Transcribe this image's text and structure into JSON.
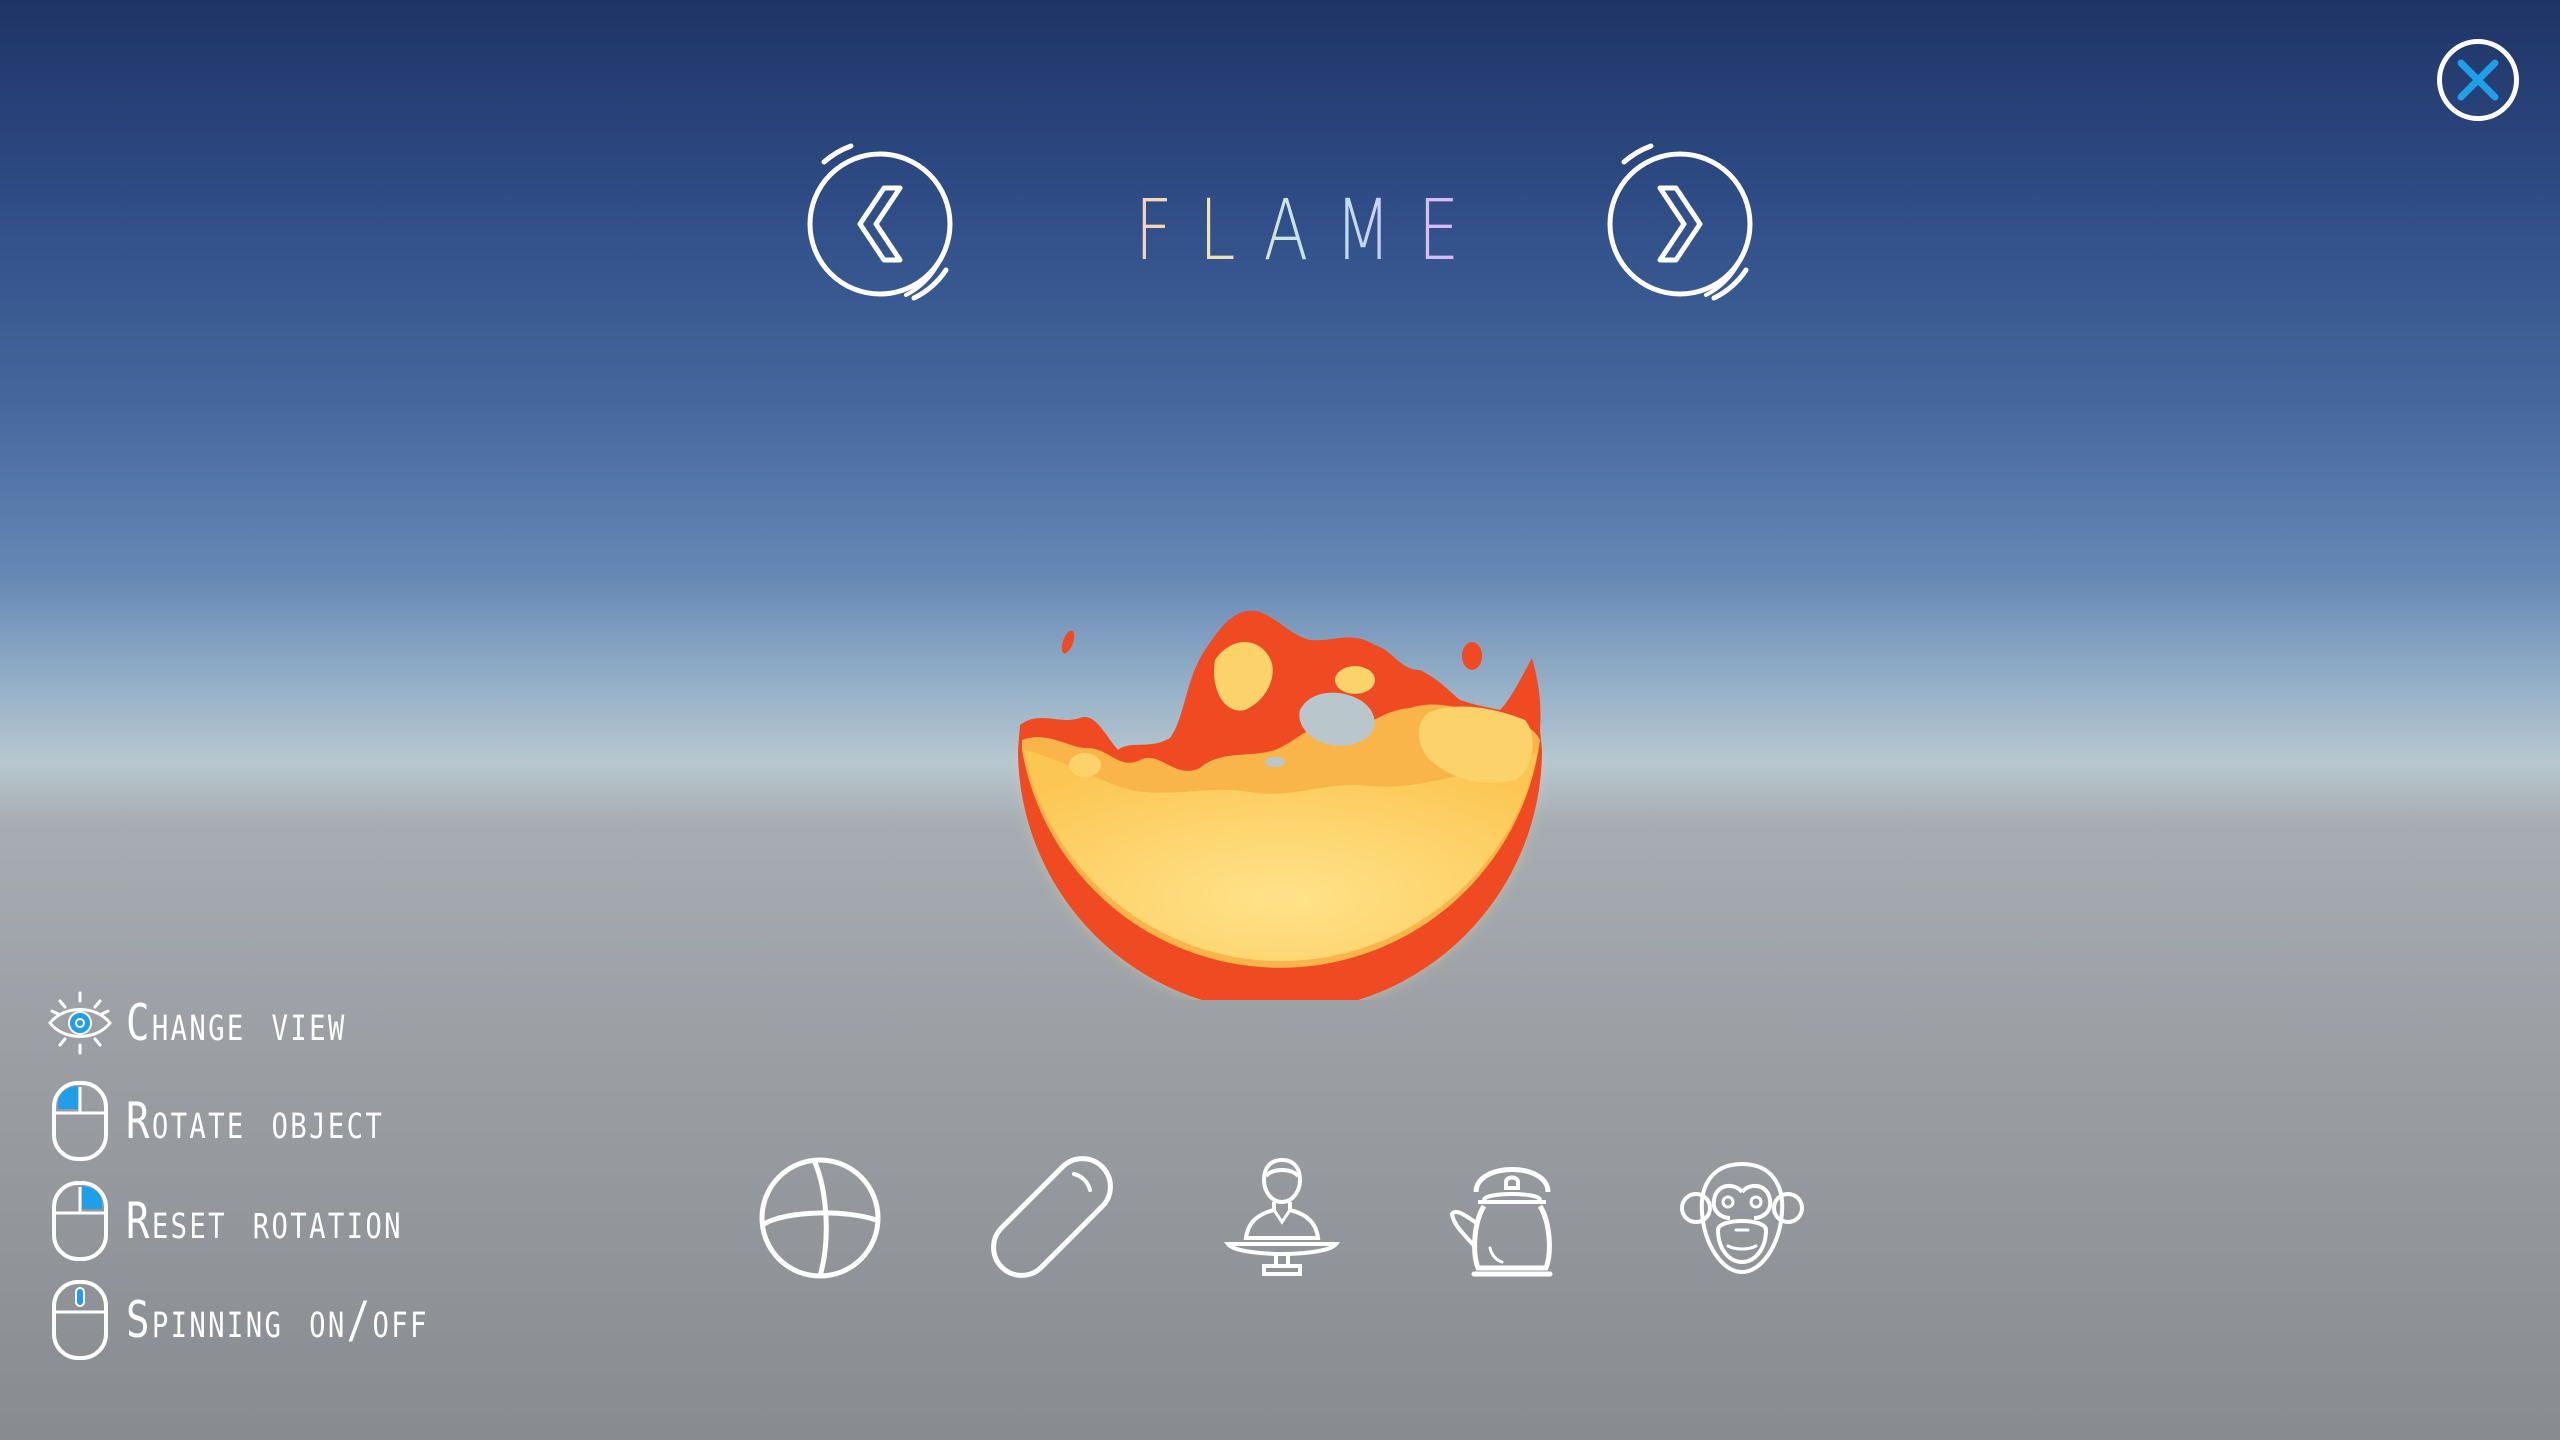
{
  "header": {
    "title": "FLAME"
  },
  "controls": [
    {
      "label": "Change view",
      "icon": "eye-icon"
    },
    {
      "label": "Rotate object",
      "icon": "mouse-left-icon"
    },
    {
      "label": "Reset rotation",
      "icon": "mouse-right-icon"
    },
    {
      "label": "Spinning on/off",
      "icon": "mouse-middle-icon"
    }
  ],
  "shapes": [
    {
      "name": "sphere",
      "icon": "sphere-icon"
    },
    {
      "name": "capsule",
      "icon": "capsule-icon"
    },
    {
      "name": "bust",
      "icon": "bust-icon"
    },
    {
      "name": "teapot",
      "icon": "teapot-icon"
    },
    {
      "name": "monkey",
      "icon": "monkey-icon"
    }
  ],
  "colors": {
    "accent": "#1e9fe8",
    "icon_stroke": "#ffffff",
    "flame_core": "#ffd46e",
    "flame_mid": "#f9b54a",
    "flame_edge": "#f04a22"
  }
}
